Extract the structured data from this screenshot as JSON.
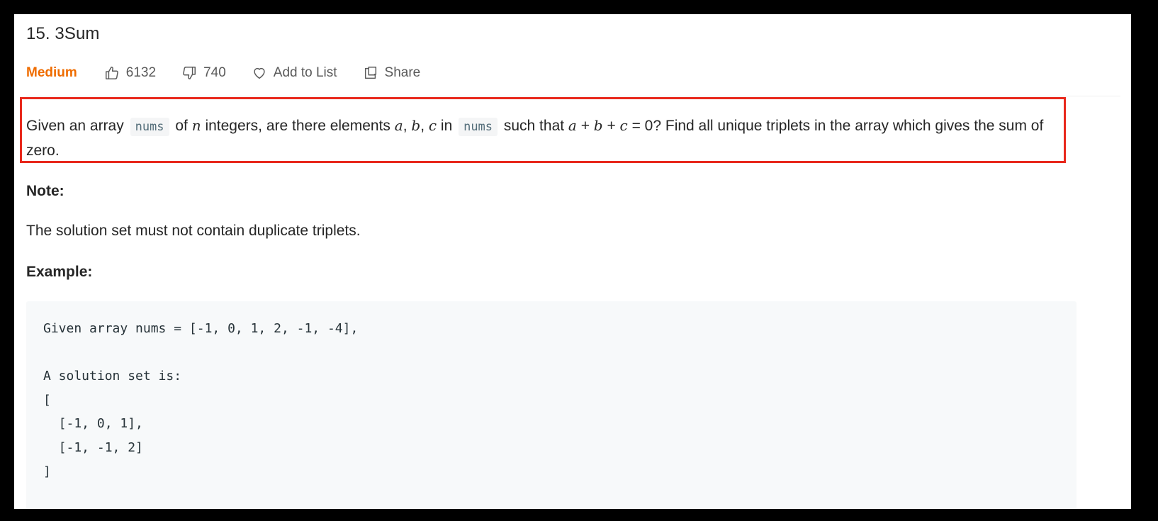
{
  "problem": {
    "title": "15. 3Sum",
    "difficulty": "Medium",
    "likes": "6132",
    "dislikes": "740",
    "add_to_list_label": "Add to List",
    "share_label": "Share"
  },
  "description": {
    "part1": "Given an array ",
    "code1": "nums",
    "part2": " of ",
    "var_n": "n",
    "part3": " integers, are there elements ",
    "var_a": "a",
    "sep1": ", ",
    "var_b": "b",
    "sep2": ", ",
    "var_c": "c",
    "part4": " in ",
    "code2": "nums",
    "part5": " such that ",
    "eq_a": "a",
    "plus1": " + ",
    "eq_b": "b",
    "plus2": " + ",
    "eq_c": "c",
    "part6": " = 0? Find all unique triplets in the array which gives the sum of zero."
  },
  "note": {
    "heading": "Note:",
    "text": "The solution set must not contain duplicate triplets."
  },
  "example": {
    "heading": "Example:",
    "code": "Given array nums = [-1, 0, 1, 2, -1, -4],\n\nA solution set is:\n[\n  [-1, 0, 1],\n  [-1, -1, 2]\n]"
  },
  "colors": {
    "difficulty": "#ef6c00",
    "highlight_border": "#e8281c"
  },
  "icons": {
    "like": "thumbs-up-icon",
    "dislike": "thumbs-down-icon",
    "add_to_list": "heart-icon",
    "share": "share-icon"
  }
}
